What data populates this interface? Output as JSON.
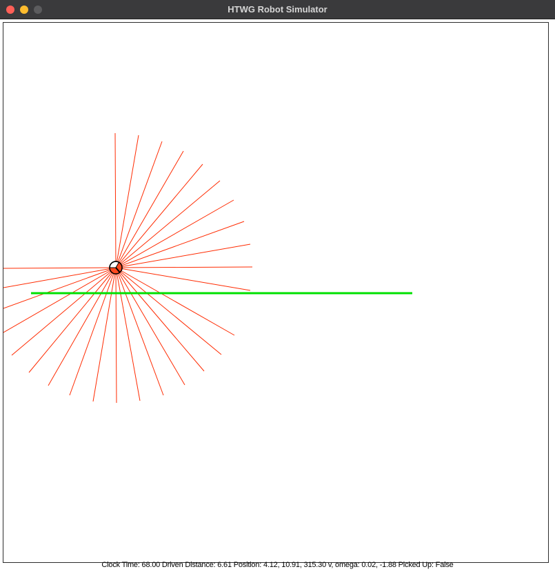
{
  "window": {
    "title": "HTWG Robot Simulator"
  },
  "status_bar": {
    "text": "Clock Time: 68.00 Driven Distance: 6.61 Position: 4.12, 10.91, 315.30 v, omega: 0.02, -1.88 Picked Up: False"
  },
  "colors": {
    "laser_beam": "#ff2a00",
    "wall": "#00e000",
    "robot_body": "#ff4a1f",
    "robot_outline": "#000000"
  }
}
